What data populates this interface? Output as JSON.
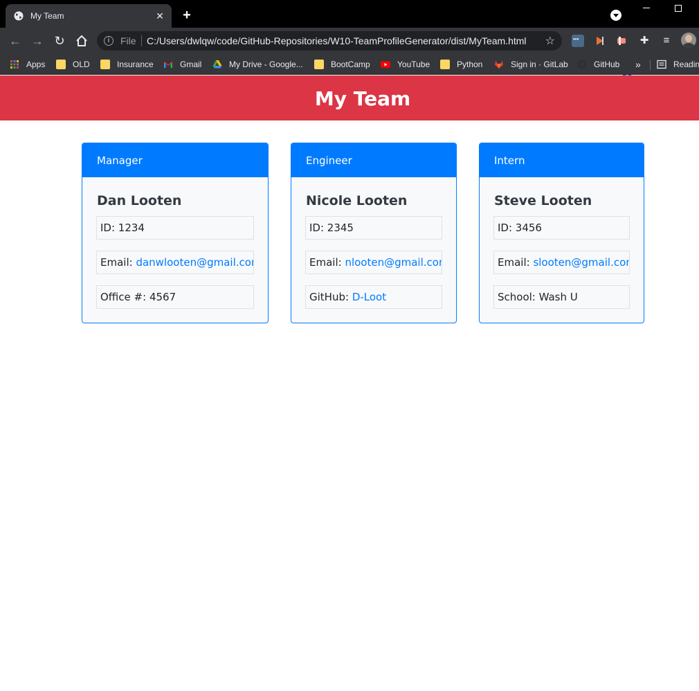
{
  "browser": {
    "tab_title": "My Team",
    "omnibox": {
      "scheme_label": "File",
      "url": "C:/Users/dwlqw/code/GitHub-Repositories/W10-TeamProfileGenerator/dist/MyTeam.html"
    },
    "extension_badge": "1",
    "bookmarks": [
      {
        "label": "Apps",
        "icon": "apps-grid-icon"
      },
      {
        "label": "OLD",
        "icon": "folder-icon"
      },
      {
        "label": "Insurance",
        "icon": "folder-icon"
      },
      {
        "label": "Gmail",
        "icon": "gmail-icon"
      },
      {
        "label": "My Drive - Google...",
        "icon": "google-drive-icon"
      },
      {
        "label": "BootCamp",
        "icon": "folder-icon"
      },
      {
        "label": "YouTube",
        "icon": "youtube-icon"
      },
      {
        "label": "Python",
        "icon": "folder-icon"
      },
      {
        "label": "Sign in · GitLab",
        "icon": "gitlab-icon"
      },
      {
        "label": "GitHub",
        "icon": "github-icon"
      }
    ],
    "reading_list_label": "Readin"
  },
  "page": {
    "title": "My Team",
    "header_color": "#dc3545",
    "accent_color": "#007bff"
  },
  "team": [
    {
      "role": "Manager",
      "name": "Dan Looten",
      "id_label": "ID: 1234",
      "email_prefix": "Email: ",
      "email": "danwlooten@gmail.com",
      "extra_prefix": "Office #: 4567",
      "extra_link": ""
    },
    {
      "role": "Engineer",
      "name": "Nicole Looten",
      "id_label": "ID: 2345",
      "email_prefix": "Email: ",
      "email": "nlooten@gmail.com",
      "extra_prefix": "GitHub: ",
      "extra_link": "D-Loot"
    },
    {
      "role": "Intern",
      "name": "Steve Looten",
      "id_label": "ID: 3456",
      "email_prefix": "Email: ",
      "email": "slooten@gmail.com",
      "extra_prefix": "School: Wash U",
      "extra_link": ""
    }
  ]
}
